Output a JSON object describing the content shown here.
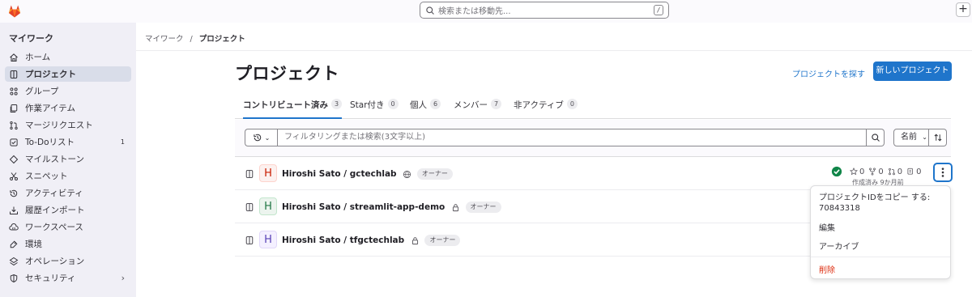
{
  "topbar": {
    "search_placeholder": "検索または移動先...",
    "search_shortcut": "/",
    "plus_label": "+"
  },
  "sidebar": {
    "title": "マイワーク",
    "items": [
      {
        "label": "ホーム",
        "icon": "home-icon"
      },
      {
        "label": "プロジェクト",
        "icon": "project-icon",
        "active": true
      },
      {
        "label": "グループ",
        "icon": "group-icon"
      },
      {
        "label": "作業アイテム",
        "icon": "work-items-icon"
      },
      {
        "label": "マージリクエスト",
        "icon": "merge-request-icon"
      },
      {
        "label": "To-Doリスト",
        "icon": "todo-icon",
        "count": "1"
      },
      {
        "label": "マイルストーン",
        "icon": "milestone-icon"
      },
      {
        "label": "スニペット",
        "icon": "snippet-icon"
      },
      {
        "label": "アクティビティ",
        "icon": "activity-icon"
      },
      {
        "label": "履歴インポート",
        "icon": "import-icon"
      },
      {
        "label": "ワークスペース",
        "icon": "workspace-icon"
      },
      {
        "label": "環境",
        "icon": "environment-icon"
      },
      {
        "label": "オペレーション",
        "icon": "operations-icon"
      },
      {
        "label": "セキュリティ",
        "icon": "security-icon",
        "chevron": "›"
      }
    ]
  },
  "breadcrumb": {
    "parent": "マイワーク",
    "separator": "/",
    "current": "プロジェクト"
  },
  "page": {
    "title": "プロジェクト",
    "explore_link": "プロジェクトを探す",
    "new_project_button": "新しいプロジェクト"
  },
  "tabs": [
    {
      "label": "コントリビュート済み",
      "count": "3",
      "active": true
    },
    {
      "label": "Star付き",
      "count": "0"
    },
    {
      "label": "個人",
      "count": "6"
    },
    {
      "label": "メンバー",
      "count": "7"
    },
    {
      "label": "非アクティブ",
      "count": "0"
    }
  ],
  "filter": {
    "placeholder": "フィルタリングまたは検索(3文字以上)",
    "sort_label": "名前",
    "sort_chevron": "⌄"
  },
  "projects": [
    {
      "avatar_letter": "H",
      "name": "Hiroshi Sato / gctechlab",
      "visibility": "public-icon",
      "role": "オーナー",
      "avatar_bg": "#fcf1ef",
      "avatar_fg": "#c91c00"
    },
    {
      "avatar_letter": "H",
      "name": "Hiroshi Sato / streamlit-app-demo",
      "visibility": "lock-icon",
      "role": "オーナー",
      "avatar_bg": "#ecf4ee",
      "avatar_fg": "#217645"
    },
    {
      "avatar_letter": "H",
      "name": "Hiroshi Sato / tfgctechlab",
      "visibility": "lock-icon",
      "role": "オーナー",
      "avatar_bg": "#f4f0ff",
      "avatar_fg": "#5943b6"
    }
  ],
  "first_project_stats": {
    "stars": "0",
    "forks": "0",
    "merge_requests": "0",
    "issues": "0",
    "updated": "作成済み 9か月前",
    "pipeline_status": "success"
  },
  "dropdown": {
    "copy_id_label": "プロジェクトIDをコピー する:",
    "project_id": "70843318",
    "edit": "編集",
    "archive": "アーカイブ",
    "delete": "削除"
  },
  "colors": {
    "accent": "#1f75cb",
    "danger": "#dd2b0e",
    "success": "#108548"
  }
}
